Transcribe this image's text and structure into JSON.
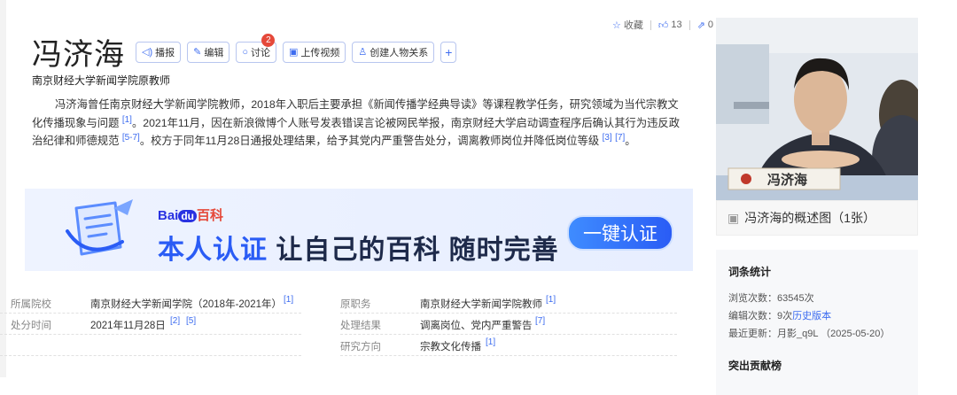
{
  "title": "冯济海",
  "toolbar": {
    "play": "播报",
    "edit": "编辑",
    "discuss": "讨论",
    "discuss_badge": "2",
    "upload_video": "上传视频",
    "relation": "创建人物关系",
    "plus": "+"
  },
  "actions": {
    "collect": "收藏",
    "likes": "13",
    "shares": "0"
  },
  "subtitle": "南京财经大学新闻学院原教师",
  "summary": {
    "p1": "冯济海曾任南京财经大学新闻学院教师，2018年入职后主要承担《新闻传播学经典导读》等课程教学任务，研究领域为当代宗教文化传播现象与问题",
    "r1": "[1]",
    "p2": "。2021年11月，因在新浪微博个人账号发表错误言论被网民举报，南京财经大学启动调查程序后确认其行为违反政治纪律和师德规范",
    "r2": "[5-7]",
    "p3": "。校方于同年11月28日通报处理结果，给予其党内严重警告处分，调离教师岗位并降低岗位等级",
    "r3": "[3]",
    "r4": "[7]",
    "p4": "。"
  },
  "banner": {
    "logo_bai": "Bai",
    "logo_du": "du",
    "logo_baike": "百科",
    "slogan_blue": "本人认证",
    "slogan_rest": " 让自己的百科 随时完善",
    "button": "一键认证"
  },
  "info": {
    "school_label": "所属院校",
    "school_value": "南京财经大学新闻学院（2018年-2021年）",
    "school_ref": "[1]",
    "former_label": "原职务",
    "former_value": "南京财经大学新闻学院教师",
    "former_ref": "[1]",
    "time_label": "处分时间",
    "time_value": "2021年11月28日",
    "time_ref1": "[2]",
    "time_ref2": "[5]",
    "result_label": "处理结果",
    "result_value": "调离岗位、党内严重警告",
    "result_ref": "[7]",
    "research_label": "研究方向",
    "research_value": "宗教文化传播",
    "research_ref": "[1]"
  },
  "side": {
    "name_plate": "冯济海",
    "caption": "冯济海的概述图（1张）",
    "stats_title": "词条统计",
    "views": "浏览次数：63545次",
    "edits_prefix": "编辑次数：9次",
    "history_link": "历史版本",
    "updated": "最近更新：月影_q9L （2025-05-20）",
    "contrib_title": "突出贡献榜"
  }
}
